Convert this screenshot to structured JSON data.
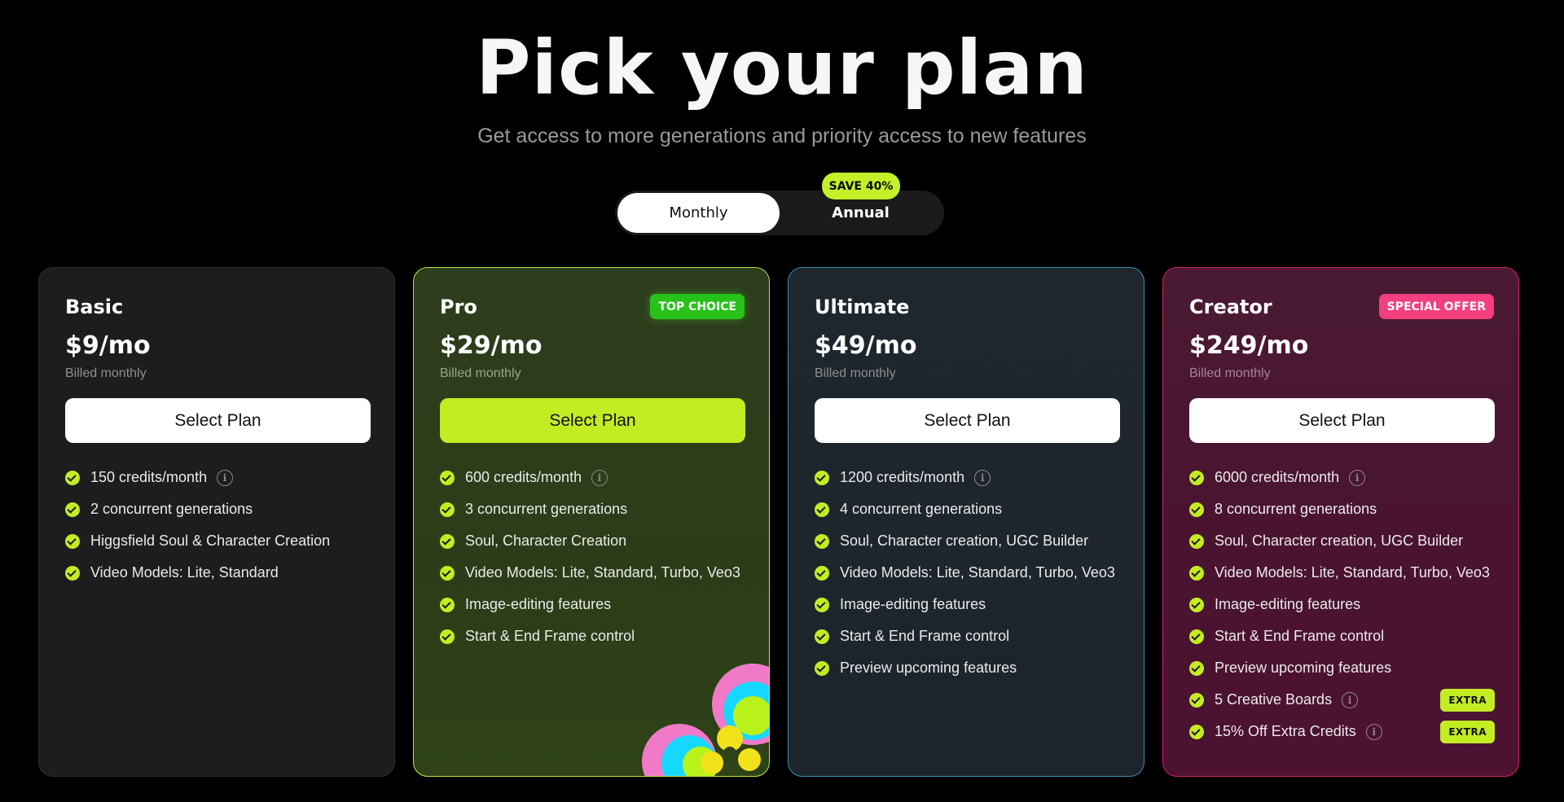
{
  "header": {
    "title": "Pick your plan",
    "subtitle": "Get access to more generations and priority access to new features"
  },
  "billing_toggle": {
    "monthly_label": "Monthly",
    "annual_label": "Annual",
    "save_badge": "SAVE 40%",
    "selected": "Monthly"
  },
  "plans": [
    {
      "name": "Basic",
      "price": "$9/mo",
      "billed": "Billed monthly",
      "button": "Select Plan",
      "features": [
        "150 credits/month",
        "2 concurrent generations",
        "Higgsfield Soul & Character Creation",
        "Video Models: Lite, Standard"
      ]
    },
    {
      "name": "Pro",
      "price": "$29/mo",
      "billed": "Billed monthly",
      "button": "Select Plan",
      "badge": "TOP CHOICE",
      "features": [
        "600 credits/month",
        "3 concurrent generations",
        "Soul, Character Creation",
        "Video Models: Lite, Standard, Turbo, Veo3",
        "Image-editing features",
        "Start & End Frame control"
      ]
    },
    {
      "name": "Ultimate",
      "price": "$49/mo",
      "billed": "Billed monthly",
      "button": "Select Plan",
      "features": [
        "1200 credits/month",
        "4 concurrent generations",
        "Soul, Character creation, UGC Builder",
        "Video Models: Lite, Standard, Turbo, Veo3",
        "Image-editing features",
        "Start & End Frame control",
        "Preview upcoming features"
      ]
    },
    {
      "name": "Creator",
      "price": "$249/mo",
      "billed": "Billed monthly",
      "button": "Select Plan",
      "badge": "SPECIAL OFFER",
      "features": [
        "6000 credits/month",
        "8 concurrent generations",
        "Soul, Character creation, UGC Builder",
        "Video Models: Lite, Standard, Turbo, Veo3",
        "Image-editing features",
        "Start & End Frame control",
        "Preview upcoming features",
        "5 Creative Boards",
        "15% Off Extra Credits"
      ],
      "extra_label": "EXTRA"
    }
  ],
  "colors": {
    "accent_lime": "#c3ec23",
    "pro_border": "#b7e63c",
    "ultimate_border": "#3f8db0",
    "creator_border": "#d61d6a",
    "top_choice_badge": "#27c21a",
    "special_offer_badge": "#f23f7d"
  },
  "icons": {
    "feature_bullet": "check-circle-icon",
    "tooltip": "info-icon"
  }
}
